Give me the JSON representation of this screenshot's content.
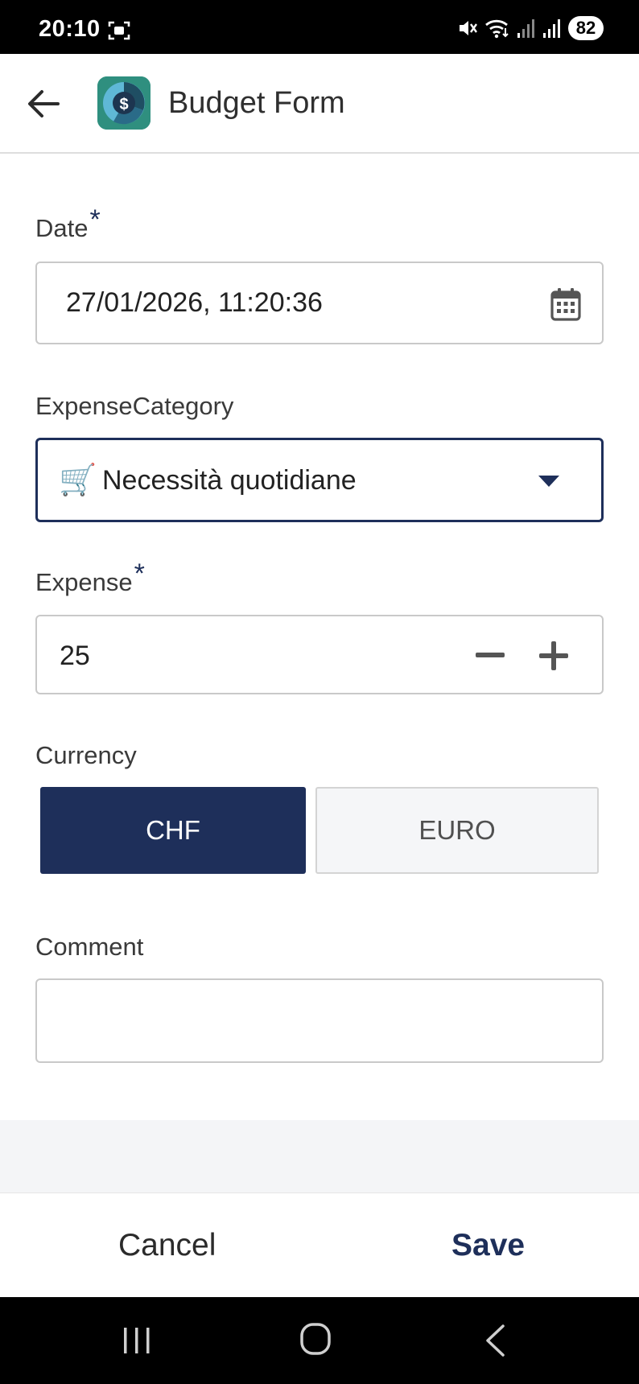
{
  "status_bar": {
    "time": "20:10",
    "battery": "82",
    "icons": [
      "screenshot-icon",
      "mute-icon",
      "wifi-icon",
      "signal-icon",
      "signal-icon"
    ]
  },
  "app_bar": {
    "title": "Budget Form",
    "logo_glyph": "$"
  },
  "form": {
    "date": {
      "label": "Date",
      "required_mark": "*",
      "value": "27/01/2026, 11:20:36"
    },
    "expense_category": {
      "label": "ExpenseCategory",
      "icon": "🛒",
      "value": "Necessità quotidiane"
    },
    "expense": {
      "label": "Expense",
      "required_mark": "*",
      "value": "25"
    },
    "currency": {
      "label": "Currency",
      "options": [
        "CHF",
        "EURO"
      ],
      "selected": "CHF"
    },
    "comment": {
      "label": "Comment",
      "value": ""
    }
  },
  "actions": {
    "cancel": "Cancel",
    "save": "Save"
  },
  "colors": {
    "accent": "#1e2f5a",
    "border": "#c9c9c9",
    "unselected_bg": "#f5f6f8"
  }
}
